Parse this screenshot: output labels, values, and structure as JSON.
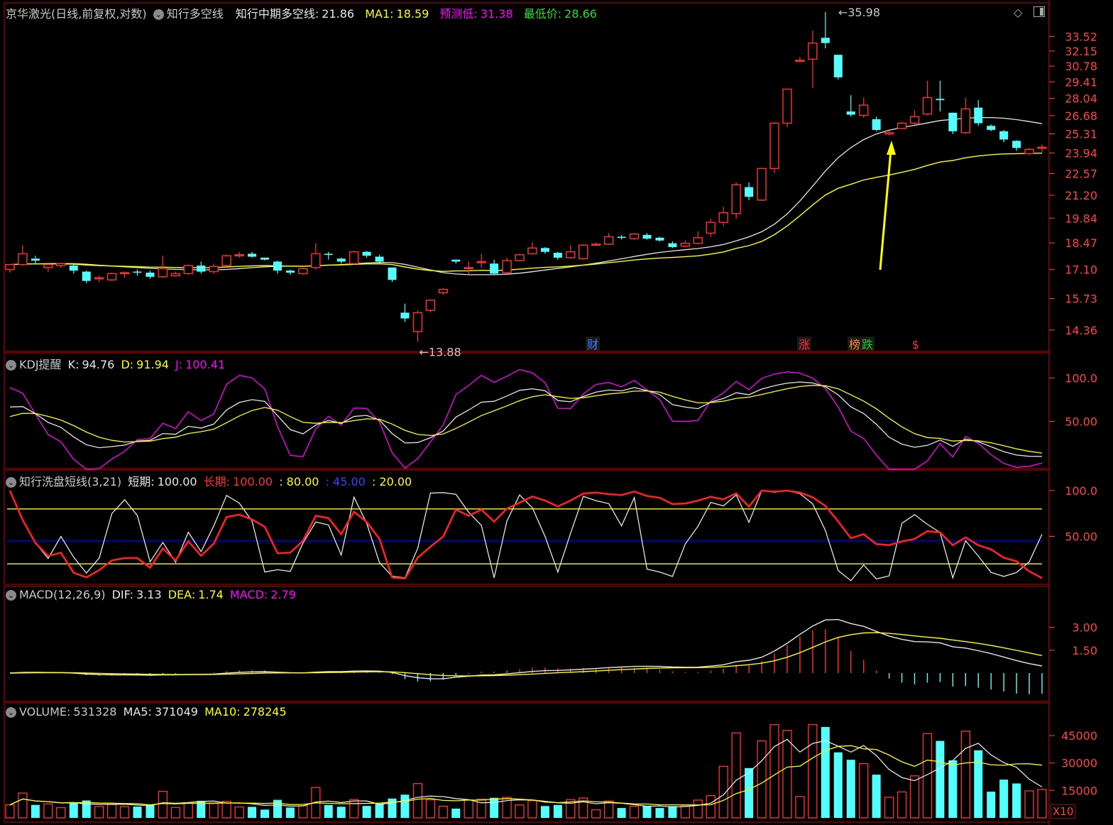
{
  "header": {
    "stock": "京华激光(日线,前复权,对数)",
    "indicator": "知行多空线",
    "main_label": "知行中期多空线:",
    "main_value": "21.86",
    "ma1_label": "MA1:",
    "ma1_value": "18.59",
    "pred_low_label": "预测低:",
    "pred_low_value": "31.38",
    "lowest_label": "最低价:",
    "lowest_value": "28.66"
  },
  "price_axis": [
    "33.52",
    "32.15",
    "30.78",
    "29.41",
    "28.04",
    "26.68",
    "25.31",
    "23.94",
    "22.57",
    "21.20",
    "19.84",
    "18.47",
    "17.10",
    "15.73",
    "14.36"
  ],
  "price_marks": {
    "high": "35.98",
    "low": "13.88"
  },
  "event_badges": [
    {
      "text": "财",
      "color": "#3a7fff"
    },
    {
      "text": "涨",
      "color": "#ff3030"
    },
    {
      "text": "榜",
      "color": "#ff8a2a"
    },
    {
      "text": "跌",
      "color": "#22cc22"
    },
    {
      "text": "$",
      "color": "#ff3030"
    }
  ],
  "kdj": {
    "name": "KDJ提醒",
    "k_label": "K:",
    "k_value": "94.76",
    "d_label": "D:",
    "d_value": "91.94",
    "j_label": "J:",
    "j_value": "100.41",
    "axis": [
      "100.0",
      "50.00"
    ]
  },
  "wash": {
    "name": "知行洗盘短线(3,21)",
    "short_label": "短期:",
    "short_value": "100.00",
    "long_label": "长期:",
    "long_value": "100.00",
    "level_80": ": 80.00",
    "level_45": ": 45.00",
    "level_20": ": 20.00",
    "axis": [
      "100.0",
      "50.00"
    ]
  },
  "macd": {
    "name": "MACD(12,26,9)",
    "dif_label": "DIF:",
    "dif_value": "3.13",
    "dea_label": "DEA:",
    "dea_value": "1.74",
    "macd_label": "MACD:",
    "macd_value": "2.79",
    "axis": [
      "3.00",
      "1.50"
    ]
  },
  "volume": {
    "name": "VOLUME:",
    "value": "531328",
    "ma5_label": "MA5:",
    "ma5_value": "371049",
    "ma10_label": "MA10:",
    "ma10_value": "278245",
    "axis": [
      "45000",
      "30000",
      "15000"
    ],
    "unit": "X10"
  },
  "colors": {
    "up": "#ff3232",
    "down": "#54ffff",
    "ma_white": "#e6e6e6",
    "ma_yellow": "#ffff00",
    "frame": "#a00000",
    "axis_text": "#ff4040",
    "purple": "#ff00ff",
    "blue": "#0000ff"
  },
  "chart_data": {
    "type": "candlestick",
    "title": "京华激光(日线,前复权,对数)",
    "y_scale": "log",
    "ylim": [
      13.5,
      36.5
    ],
    "candles": [
      [
        17.1,
        17.35,
        16.95,
        17.35
      ],
      [
        17.35,
        17.9,
        17.3,
        18.35
      ],
      [
        17.65,
        17.55,
        17.4,
        17.8
      ],
      [
        17.2,
        17.35,
        17.0,
        17.45
      ],
      [
        17.3,
        17.4,
        17.2,
        17.45
      ],
      [
        17.3,
        17.05,
        16.9,
        17.4
      ],
      [
        17.0,
        16.55,
        16.45,
        17.05
      ],
      [
        16.7,
        16.7,
        16.5,
        16.8
      ],
      [
        16.6,
        16.9,
        16.55,
        16.95
      ],
      [
        16.9,
        16.95,
        16.7,
        17.0
      ],
      [
        17.0,
        16.95,
        16.8,
        17.1
      ],
      [
        16.95,
        16.75,
        16.65,
        17.05
      ],
      [
        16.75,
        17.15,
        16.7,
        17.8
      ],
      [
        16.8,
        16.9,
        16.75,
        17.0
      ],
      [
        16.9,
        17.3,
        16.85,
        17.35
      ],
      [
        17.3,
        17.0,
        16.9,
        17.5
      ],
      [
        17.0,
        17.25,
        16.9,
        17.4
      ],
      [
        17.3,
        17.8,
        17.25,
        17.85
      ],
      [
        17.8,
        17.85,
        17.7,
        18.0
      ],
      [
        17.9,
        17.75,
        17.7,
        18.0
      ],
      [
        17.7,
        17.6,
        17.55,
        17.7
      ],
      [
        17.5,
        17.05,
        16.9,
        17.55
      ],
      [
        17.05,
        16.95,
        16.85,
        17.1
      ],
      [
        16.9,
        17.15,
        16.85,
        17.2
      ],
      [
        17.2,
        17.9,
        17.1,
        18.45
      ],
      [
        17.9,
        17.85,
        17.6,
        18.0
      ],
      [
        17.65,
        17.5,
        17.4,
        17.7
      ],
      [
        17.4,
        18.0,
        17.35,
        18.05
      ],
      [
        18.0,
        17.8,
        17.7,
        18.05
      ],
      [
        17.75,
        17.5,
        17.4,
        17.85
      ],
      [
        17.2,
        16.6,
        16.5,
        17.2
      ],
      [
        15.1,
        14.85,
        14.7,
        15.5
      ],
      [
        14.3,
        15.1,
        13.88,
        15.2
      ],
      [
        15.2,
        15.65,
        15.1,
        15.7
      ],
      [
        16.0,
        16.15,
        15.9,
        16.2
      ],
      [
        17.6,
        17.5,
        17.4,
        17.6
      ],
      [
        17.2,
        17.2,
        16.85,
        17.5
      ],
      [
        17.5,
        17.5,
        17.2,
        17.9
      ],
      [
        17.4,
        16.9,
        16.85,
        17.6
      ],
      [
        16.95,
        17.55,
        16.9,
        17.7
      ],
      [
        17.55,
        17.85,
        17.5,
        17.9
      ],
      [
        17.9,
        18.2,
        17.85,
        18.5
      ],
      [
        18.2,
        18.0,
        17.9,
        18.25
      ],
      [
        17.95,
        17.7,
        17.6,
        18.0
      ],
      [
        17.7,
        18.0,
        17.65,
        18.35
      ],
      [
        17.65,
        18.35,
        17.6,
        18.4
      ],
      [
        18.4,
        18.4,
        18.35,
        18.5
      ],
      [
        18.4,
        18.8,
        18.35,
        19.0
      ],
      [
        18.8,
        18.75,
        18.65,
        18.9
      ],
      [
        18.7,
        18.95,
        18.65,
        19.0
      ],
      [
        18.9,
        18.7,
        18.65,
        19.0
      ],
      [
        18.75,
        18.6,
        18.55,
        18.8
      ],
      [
        18.45,
        18.25,
        18.2,
        18.55
      ],
      [
        18.3,
        18.45,
        18.25,
        18.6
      ],
      [
        18.45,
        18.75,
        18.4,
        19.1
      ],
      [
        19.0,
        19.6,
        18.8,
        19.8
      ],
      [
        19.6,
        20.15,
        19.4,
        20.5
      ],
      [
        20.1,
        21.85,
        19.8,
        22.0
      ],
      [
        21.7,
        21.1,
        20.9,
        22.0
      ],
      [
        20.9,
        22.9,
        20.85,
        22.9
      ],
      [
        22.9,
        26.1,
        22.6,
        26.2
      ],
      [
        26.1,
        28.8,
        25.8,
        28.8
      ],
      [
        31.3,
        31.3,
        31.2,
        31.6
      ],
      [
        31.4,
        32.9,
        28.9,
        34.1
      ],
      [
        33.4,
        32.9,
        32.4,
        35.98
      ],
      [
        31.8,
        29.8,
        29.6,
        31.8
      ],
      [
        27.0,
        26.75,
        26.6,
        28.3
      ],
      [
        26.7,
        27.5,
        26.5,
        28.1
      ],
      [
        26.4,
        25.6,
        25.5,
        26.6
      ],
      [
        25.3,
        25.4,
        25.2,
        25.5
      ],
      [
        25.7,
        26.1,
        25.7,
        26.2
      ],
      [
        26.1,
        26.6,
        26.0,
        27.1
      ],
      [
        26.8,
        28.1,
        26.7,
        29.5
      ],
      [
        28.0,
        27.9,
        27.0,
        29.5
      ],
      [
        26.9,
        25.5,
        25.3,
        26.9
      ],
      [
        25.4,
        27.2,
        25.3,
        28.1
      ],
      [
        27.3,
        26.1,
        25.9,
        27.9
      ],
      [
        25.9,
        25.6,
        25.5,
        26.0
      ],
      [
        25.5,
        24.9,
        24.7,
        25.6
      ],
      [
        24.8,
        24.3,
        24.1,
        24.85
      ],
      [
        23.9,
        24.2,
        23.8,
        24.3
      ],
      [
        24.3,
        24.35,
        24.0,
        24.55
      ]
    ],
    "series": [
      {
        "name": "知行中期多空线",
        "type": "line"
      },
      {
        "name": "MA1",
        "type": "line"
      }
    ],
    "annotations": [
      "35.98",
      "13.88"
    ],
    "indicators": {
      "kdj": {
        "K": 94.76,
        "D": 91.94,
        "J": 100.41
      },
      "wash": {
        "short": 100.0,
        "long": 100.0,
        "levels": [
          80.0,
          45.0,
          20.0
        ]
      },
      "macd": {
        "DIF": 3.13,
        "DEA": 1.74,
        "MACD": 2.79
      },
      "volume": {
        "VOLUME": 531328,
        "MA5": 371049,
        "MA10": 278245
      }
    }
  }
}
